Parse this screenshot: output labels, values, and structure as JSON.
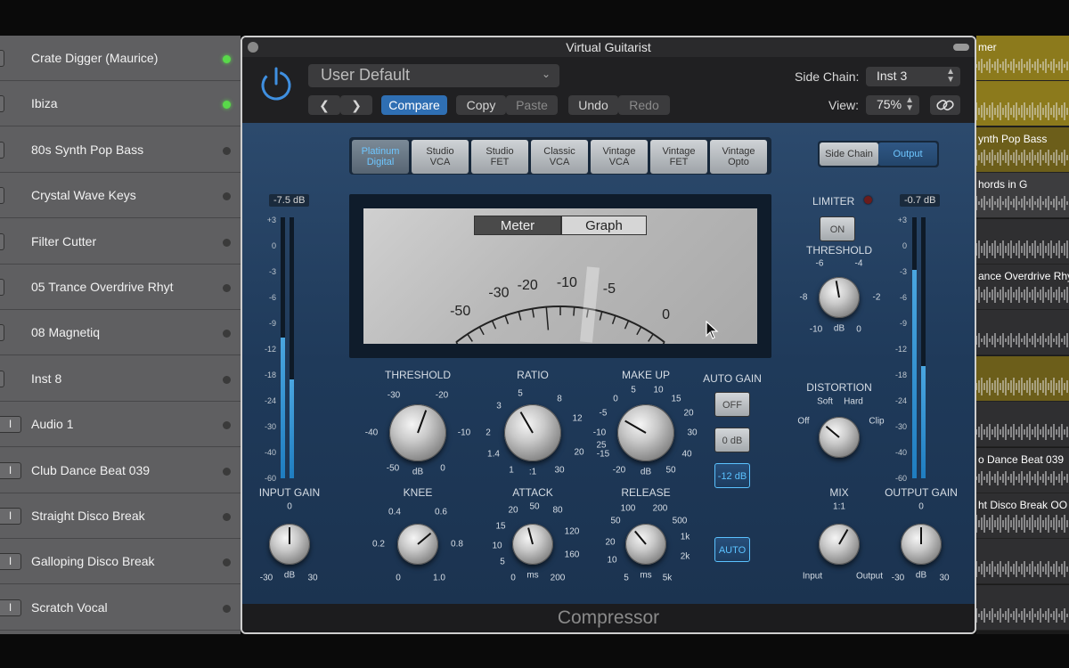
{
  "tracks": [
    {
      "name": "Crate Digger (Maurice)",
      "active": true,
      "button": ""
    },
    {
      "name": "Ibiza",
      "active": true,
      "button": ""
    },
    {
      "name": "80s Synth Pop Bass",
      "active": false,
      "button": ""
    },
    {
      "name": "Crystal Wave Keys",
      "active": false,
      "button": ""
    },
    {
      "name": "Filter Cutter",
      "active": false,
      "button": ""
    },
    {
      "name": "05 Trance Overdrive Rhyt",
      "active": false,
      "button": ""
    },
    {
      "name": "08 Magnetiq",
      "active": false,
      "button": ""
    },
    {
      "name": "Inst 8",
      "active": false,
      "button": ""
    },
    {
      "name": "Audio 1",
      "active": false,
      "button": "I"
    },
    {
      "name": "Club Dance Beat 039",
      "active": false,
      "button": "I"
    },
    {
      "name": "Straight Disco Break",
      "active": false,
      "button": "I"
    },
    {
      "name": "Galloping Disco Break",
      "active": false,
      "button": "I"
    },
    {
      "name": "Scratch Vocal",
      "active": false,
      "button": "I"
    }
  ],
  "lanes": [
    {
      "label": "mer",
      "style": "yellow"
    },
    {
      "label": "",
      "style": "yellow"
    },
    {
      "label": "ynth Pop Bass",
      "style": "yellowdark"
    },
    {
      "label": "hords in G",
      "style": "gray"
    },
    {
      "label": "",
      "style": "mid"
    },
    {
      "label": "ance Overdrive Rhy",
      "style": "mid"
    },
    {
      "label": "",
      "style": "mid"
    },
    {
      "label": "",
      "style": "yellowdark"
    },
    {
      "label": "",
      "style": "mid"
    },
    {
      "label": "o Dance Beat 039",
      "style": "mid"
    },
    {
      "label": "ht Disco Break  OO",
      "style": "mid"
    },
    {
      "label": "",
      "style": "mid"
    },
    {
      "label": "",
      "style": "mid"
    }
  ],
  "window": {
    "title": "Virtual Guitarist"
  },
  "header": {
    "preset": "User Default",
    "prev_icon": "chevron-left-icon",
    "next_icon": "chevron-right-icon",
    "compare": "Compare",
    "copy": "Copy",
    "paste": "Paste",
    "undo": "Undo",
    "redo": "Redo",
    "sidechain_label": "Side Chain:",
    "sidechain_value": "Inst 3",
    "view_label": "View:",
    "view_value": "75%",
    "link_icon": "link-icon"
  },
  "models": [
    {
      "line1": "Platinum",
      "line2": "Digital",
      "active": true
    },
    {
      "line1": "Studio",
      "line2": "VCA",
      "active": false
    },
    {
      "line1": "Studio",
      "line2": "FET",
      "active": false
    },
    {
      "line1": "Classic",
      "line2": "VCA",
      "active": false
    },
    {
      "line1": "Vintage",
      "line2": "VCA",
      "active": false
    },
    {
      "line1": "Vintage",
      "line2": "FET",
      "active": false
    },
    {
      "line1": "Vintage",
      "line2": "Opto",
      "active": false
    }
  ],
  "sidechain_toggle": {
    "side_chain": "Side Chain",
    "output": "Output",
    "selected": "Output"
  },
  "input_meter": {
    "readout": "-7.5 dB",
    "level_left": 0.54,
    "level_right": 0.38
  },
  "output_meter": {
    "readout": "-0.7 dB",
    "level_left": 0.8,
    "level_right": 0.43
  },
  "meter_scale": [
    "+3",
    "0",
    "-3",
    "-6",
    "-9",
    "-12",
    "-18",
    "-24",
    "-30",
    "-40",
    "-60"
  ],
  "display": {
    "meter_tab": "Meter",
    "graph_tab": "Graph",
    "selected": "Meter",
    "scale": [
      "-50",
      "-30",
      "-20",
      "-10",
      "-5",
      "0"
    ]
  },
  "knobs": {
    "threshold": {
      "label": "THRESHOLD",
      "ticks": [
        "-30",
        "-20",
        "-10",
        "0",
        "-40",
        "-50"
      ],
      "unit": "dB"
    },
    "ratio": {
      "label": "RATIO",
      "ticks": [
        "2",
        "1.4",
        "1",
        "3",
        "5",
        "8",
        "12",
        "20",
        "30"
      ],
      "unit": ":1"
    },
    "makeup": {
      "label": "MAKE UP",
      "ticks": [
        "-10",
        "-15",
        "-20",
        "-5",
        "0",
        "5",
        "10",
        "15",
        "20",
        "30",
        "40",
        "50",
        "25"
      ],
      "unit": "dB"
    },
    "knee": {
      "label": "KNEE",
      "ticks": [
        "0.2",
        "0",
        "0.4",
        "0.6",
        "0.8",
        "1.0"
      ]
    },
    "attack": {
      "label": "ATTACK",
      "ticks": [
        "20",
        "50",
        "80",
        "15",
        "120",
        "10",
        "160",
        "5",
        "200",
        "0"
      ],
      "unit": "ms"
    },
    "release": {
      "label": "RELEASE",
      "ticks": [
        "100",
        "200",
        "50",
        "500",
        "20",
        "1k",
        "10",
        "2k",
        "5",
        "5k"
      ],
      "unit": "ms"
    },
    "input_gain": {
      "label": "INPUT GAIN",
      "ticks": [
        "0",
        "-30",
        "30"
      ],
      "unit": "dB"
    },
    "limiter_threshold": {
      "label": "THRESHOLD",
      "ticks": [
        "-6",
        "-4",
        "-8",
        "-2",
        "-10",
        "0"
      ],
      "unit": "dB"
    },
    "distortion": {
      "label": "DISTORTION",
      "ticks": [
        "Soft",
        "Hard",
        "Off",
        "Clip"
      ]
    },
    "mix": {
      "label": "MIX",
      "ticks": [
        "1:1",
        "Input",
        "Output"
      ]
    },
    "output_gain": {
      "label": "OUTPUT GAIN",
      "ticks": [
        "0",
        "-30",
        "30"
      ],
      "unit": "dB"
    }
  },
  "auto_gain": {
    "label": "AUTO GAIN",
    "off": "OFF",
    "zero": "0 dB",
    "minus12": "-12 dB",
    "selected": "-12 dB",
    "auto": "AUTO"
  },
  "limiter": {
    "label": "LIMITER",
    "on": "ON"
  },
  "footer": {
    "plugin_name": "Compressor"
  }
}
